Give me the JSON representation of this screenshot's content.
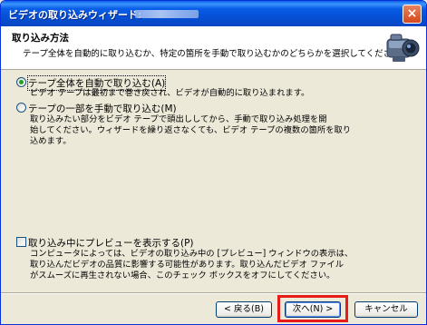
{
  "window": {
    "title": "ビデオの取り込みウィザード: ",
    "close_label": "×"
  },
  "header": {
    "title": "取り込み方法",
    "description": "テープ全体を自動的に取り込むか、特定の箇所を手動で取り込むかのどちらかを選択してください。",
    "icon": "video-camera-icon"
  },
  "options": [
    {
      "label": "テープ全体を自動で取り込む(A)",
      "selected": true,
      "description": [
        "ビデオ テープは最初まで巻き戻され、ビデオが自動的に取り込まれます。"
      ]
    },
    {
      "label": "テープの一部を手動で取り込む(M)",
      "selected": false,
      "description": [
        "取り込みたい部分をビデオ テープで頭出ししてから、手動で取り込み処理を開",
        "始してください。ウィザードを繰り返さなくても、ビデオ テープの複数の箇所を取り",
        "込めます。"
      ]
    }
  ],
  "preview": {
    "label": "取り込み中にプレビューを表示する(P)",
    "checked": false,
    "description": [
      "コンピュータによっては、ビデオの取り込み中の [プレビュー] ウィンドウの表示は、",
      "取り込んだビデオの品質に影響する可能性があります。取り込んだビデオ ファイル",
      "がスムーズに再生されない場合、このチェック ボックスをオフにしてください。"
    ]
  },
  "buttons": {
    "back": "< 戻る(B)",
    "next": "次へ(N) >",
    "cancel": "キャンセル"
  },
  "colors": {
    "titlebar": "#0a5ee8",
    "highlight": "#e81b1b",
    "dialog_bg": "#ece9d8"
  }
}
